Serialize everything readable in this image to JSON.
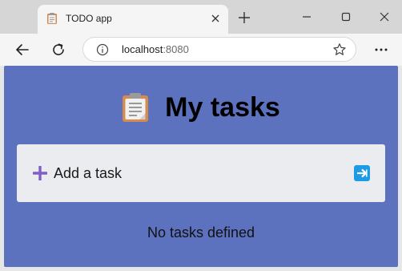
{
  "browser": {
    "tab": {
      "title": "TODO app",
      "favicon": "clipboard-icon"
    },
    "address_bar": {
      "host": "localhost",
      "port": ":8080"
    },
    "icons": {
      "back": "back-arrow-icon",
      "reload": "reload-icon",
      "info": "info-icon",
      "favorite": "star-icon",
      "menu": "more-icon",
      "new_tab": "plus-icon",
      "minimize": "minimize-icon",
      "maximize": "maximize-icon",
      "close": "close-icon"
    }
  },
  "page": {
    "heading": {
      "emoji_icon": "clipboard-icon",
      "title": "My tasks"
    },
    "task_form": {
      "placeholder": "Add a task",
      "add_icon": "plus-icon",
      "submit_icon": "right-arrow-icon"
    },
    "empty_message": "No tasks defined"
  },
  "colors": {
    "page_background": "#5d72bf",
    "form_background": "#ebecef",
    "plus_accent": "#7e5fc4",
    "submit_button": "#1e9be6"
  }
}
